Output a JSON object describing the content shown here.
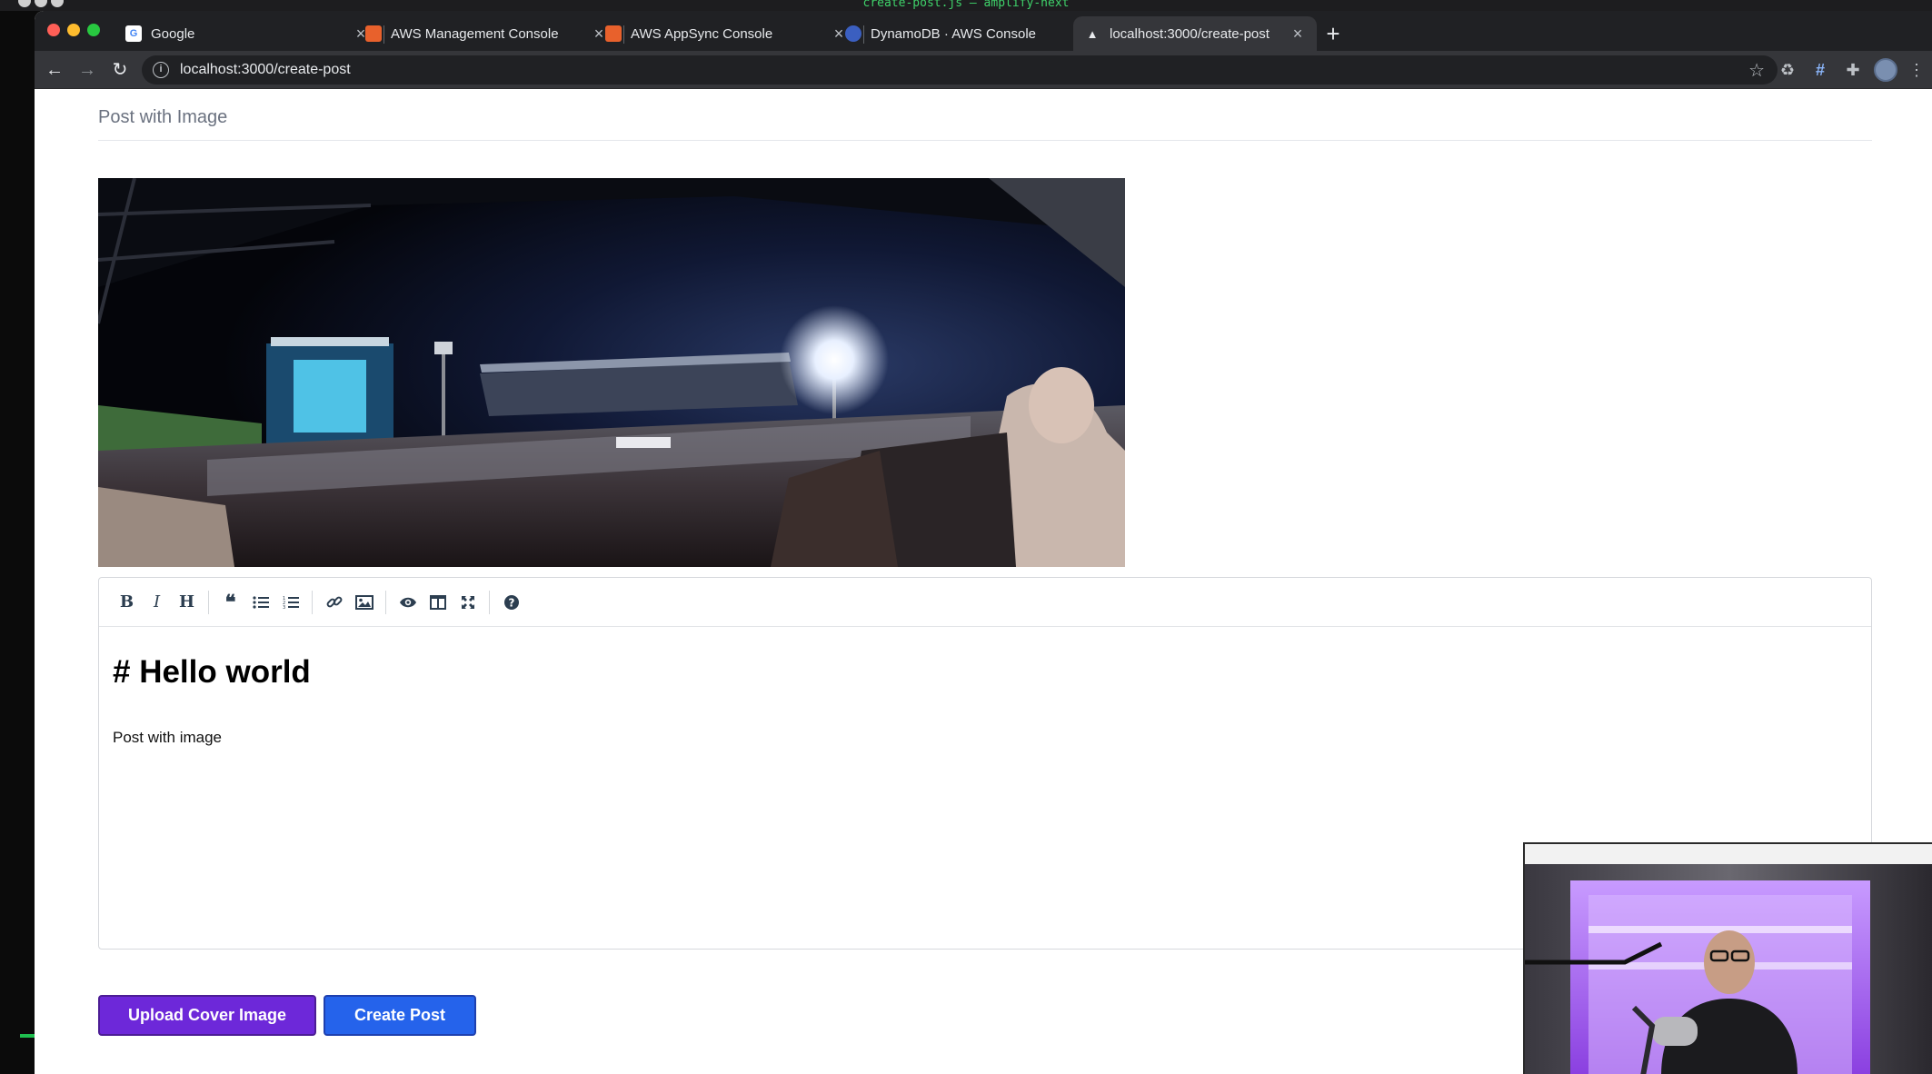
{
  "terminal": {
    "title": "create-post.js — amplify-next"
  },
  "browser": {
    "tabs": [
      {
        "label": "Google",
        "icon": "google-icon",
        "active": false
      },
      {
        "label": "AWS Management Console",
        "icon": "aws-icon",
        "active": false
      },
      {
        "label": "AWS AppSync Console",
        "icon": "aws-icon",
        "active": false
      },
      {
        "label": "DynamoDB · AWS Console",
        "icon": "dynamodb-icon",
        "active": false
      },
      {
        "label": "localhost:3000/create-post",
        "icon": "vercel-triangle-icon",
        "active": true
      }
    ],
    "url": "localhost:3000/create-post"
  },
  "page": {
    "title": "Post with Image",
    "editor": {
      "toolbar": [
        "bold",
        "italic",
        "heading",
        "quote",
        "unordered-list",
        "ordered-list",
        "link",
        "image",
        "preview",
        "side-by-side",
        "fullscreen",
        "guide"
      ],
      "heading_text": "# Hello world",
      "body_text": "Post with image"
    },
    "buttons": {
      "upload_label": "Upload Cover Image",
      "create_label": "Create Post"
    }
  },
  "colors": {
    "upload_button": "#6d28d9",
    "create_button": "#2563eb",
    "tab_strip": "#202124",
    "toolbar": "#35363a"
  }
}
